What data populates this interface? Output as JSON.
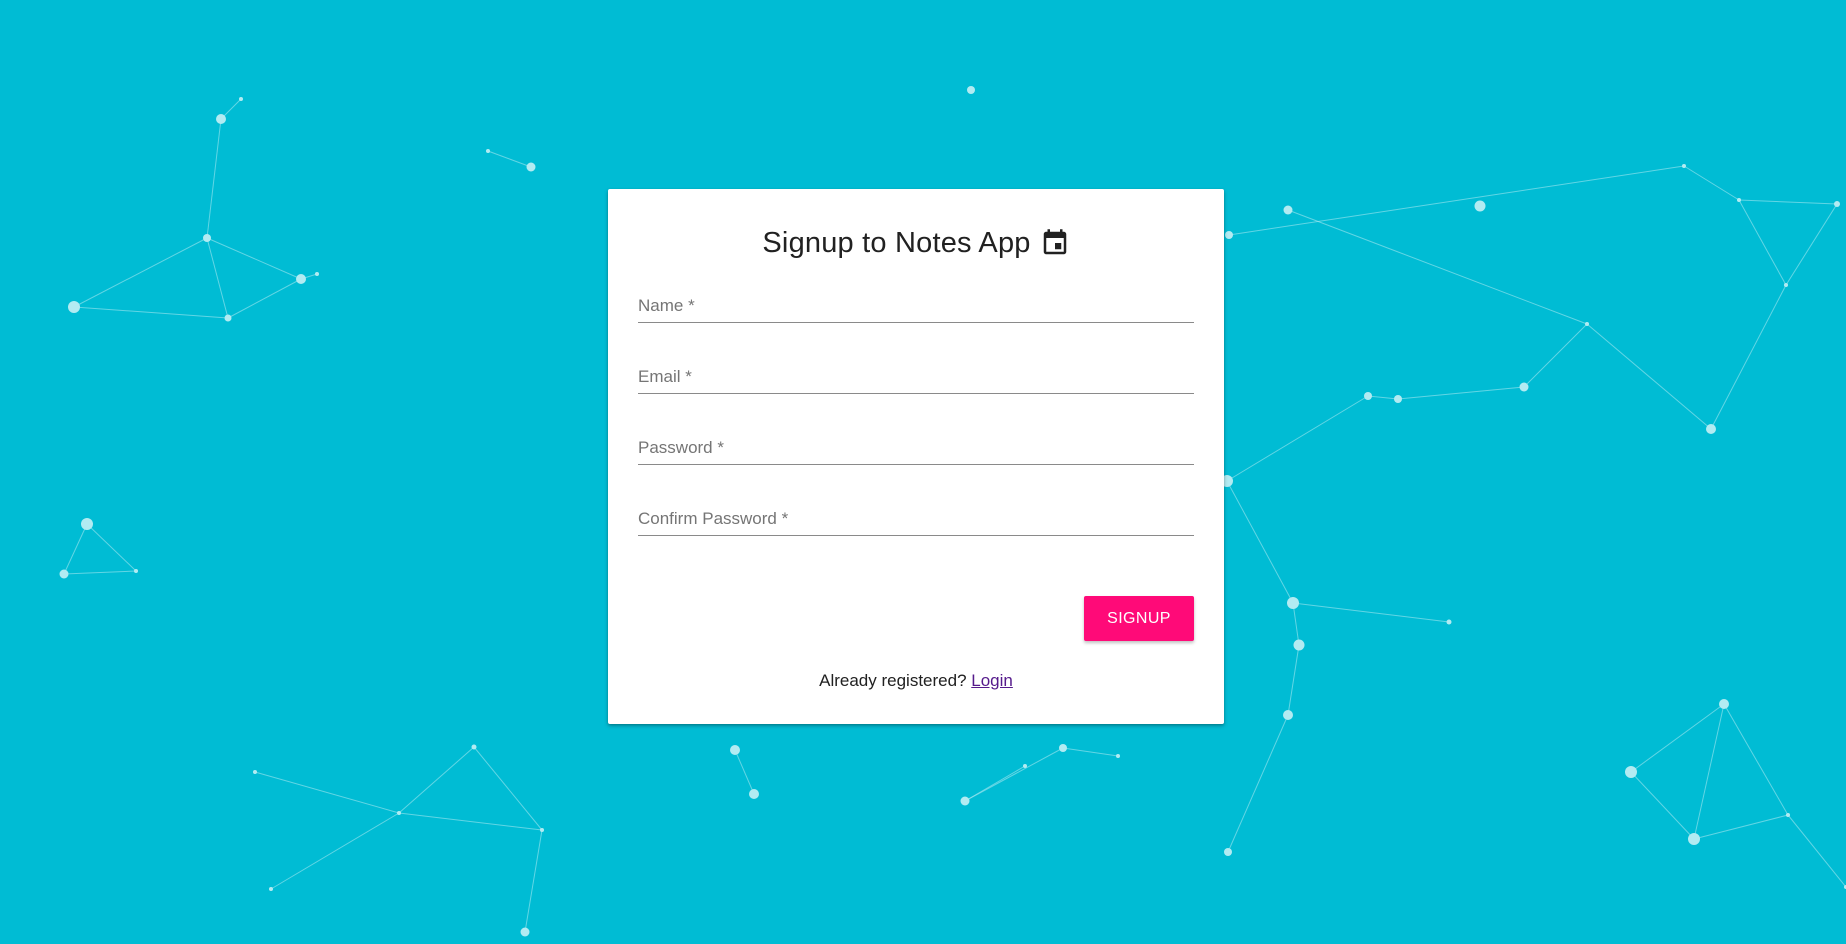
{
  "colors": {
    "background": "#00bcd4",
    "card": "#ffffff",
    "accent_button": "#ff0a78",
    "link": "#551a8b",
    "particle": "#b2ebf2"
  },
  "signup": {
    "title": "Signup to Notes App",
    "title_icon": "calendar-icon",
    "fields": {
      "name": {
        "label": "Name *",
        "value": ""
      },
      "email": {
        "label": "Email *",
        "value": ""
      },
      "password": {
        "label": "Password *",
        "value": ""
      },
      "confirm_password": {
        "label": "Confirm Password *",
        "value": ""
      }
    },
    "submit_label": "SIGNUP",
    "footer_text": "Already registered?",
    "login_link": "Login"
  }
}
